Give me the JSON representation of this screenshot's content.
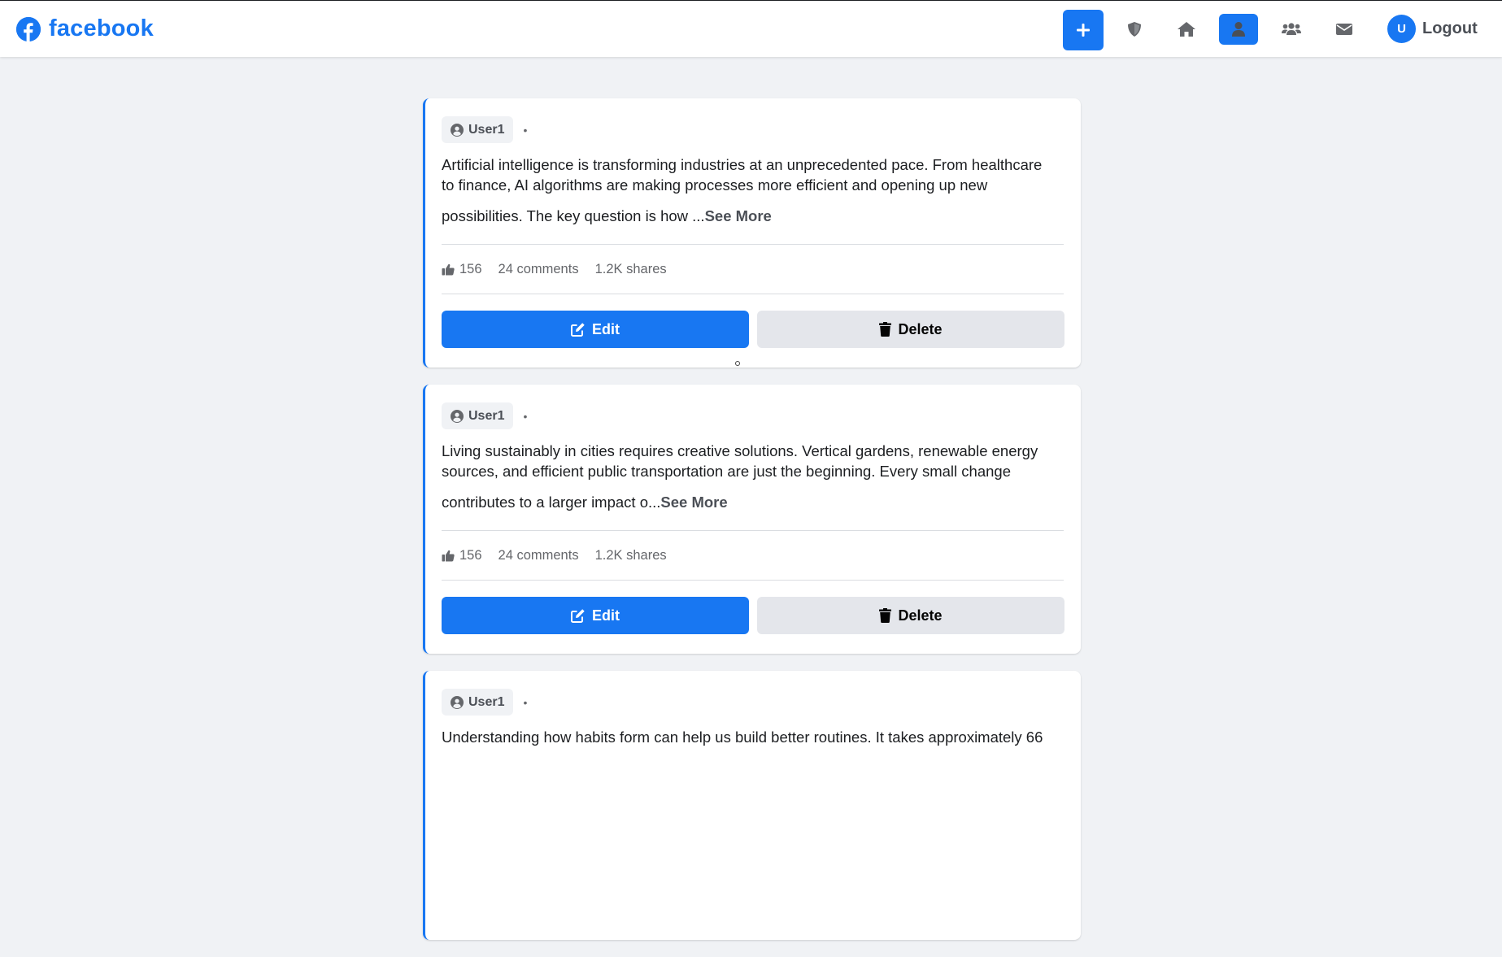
{
  "header": {
    "brand": "facebook",
    "nav": {
      "create": "create-post",
      "shield": "shield",
      "home": "home",
      "profile": "profile",
      "friends": "friends",
      "messages": "messages"
    },
    "avatar_initial": "U",
    "logout_label": "Logout",
    "accent": "#1877f2"
  },
  "posts": [
    {
      "author": "User1",
      "separator": "•",
      "text_line1": "Artificial intelligence is transforming industries at an unprecedented pace. From healthcare",
      "text_line2": "to finance, AI algorithms are making processes more efficient and opening up new",
      "text_line3": "possibilities. The key question is how ...",
      "see_more": "See More",
      "likes": "156",
      "comments": "24 comments",
      "shares": "1.2K shares",
      "edit_label": "Edit",
      "delete_label": "Delete"
    },
    {
      "author": "User1",
      "separator": "•",
      "text_line1": "Living sustainably in cities requires creative solutions. Vertical gardens, renewable energy",
      "text_line2": "sources, and efficient public transportation are just the beginning. Every small change",
      "text_line3": "contributes to a larger impact o...",
      "see_more": "See More",
      "likes": "156",
      "comments": "24 comments",
      "shares": "1.2K shares",
      "edit_label": "Edit",
      "delete_label": "Delete"
    },
    {
      "author": "User1",
      "separator": "•",
      "text_line1": "Understanding how habits form can help us build better routines. It takes approximately 66",
      "text_line2": "",
      "text_line3": "",
      "see_more": "",
      "likes": "",
      "comments": "",
      "shares": "",
      "edit_label": "",
      "delete_label": ""
    }
  ]
}
